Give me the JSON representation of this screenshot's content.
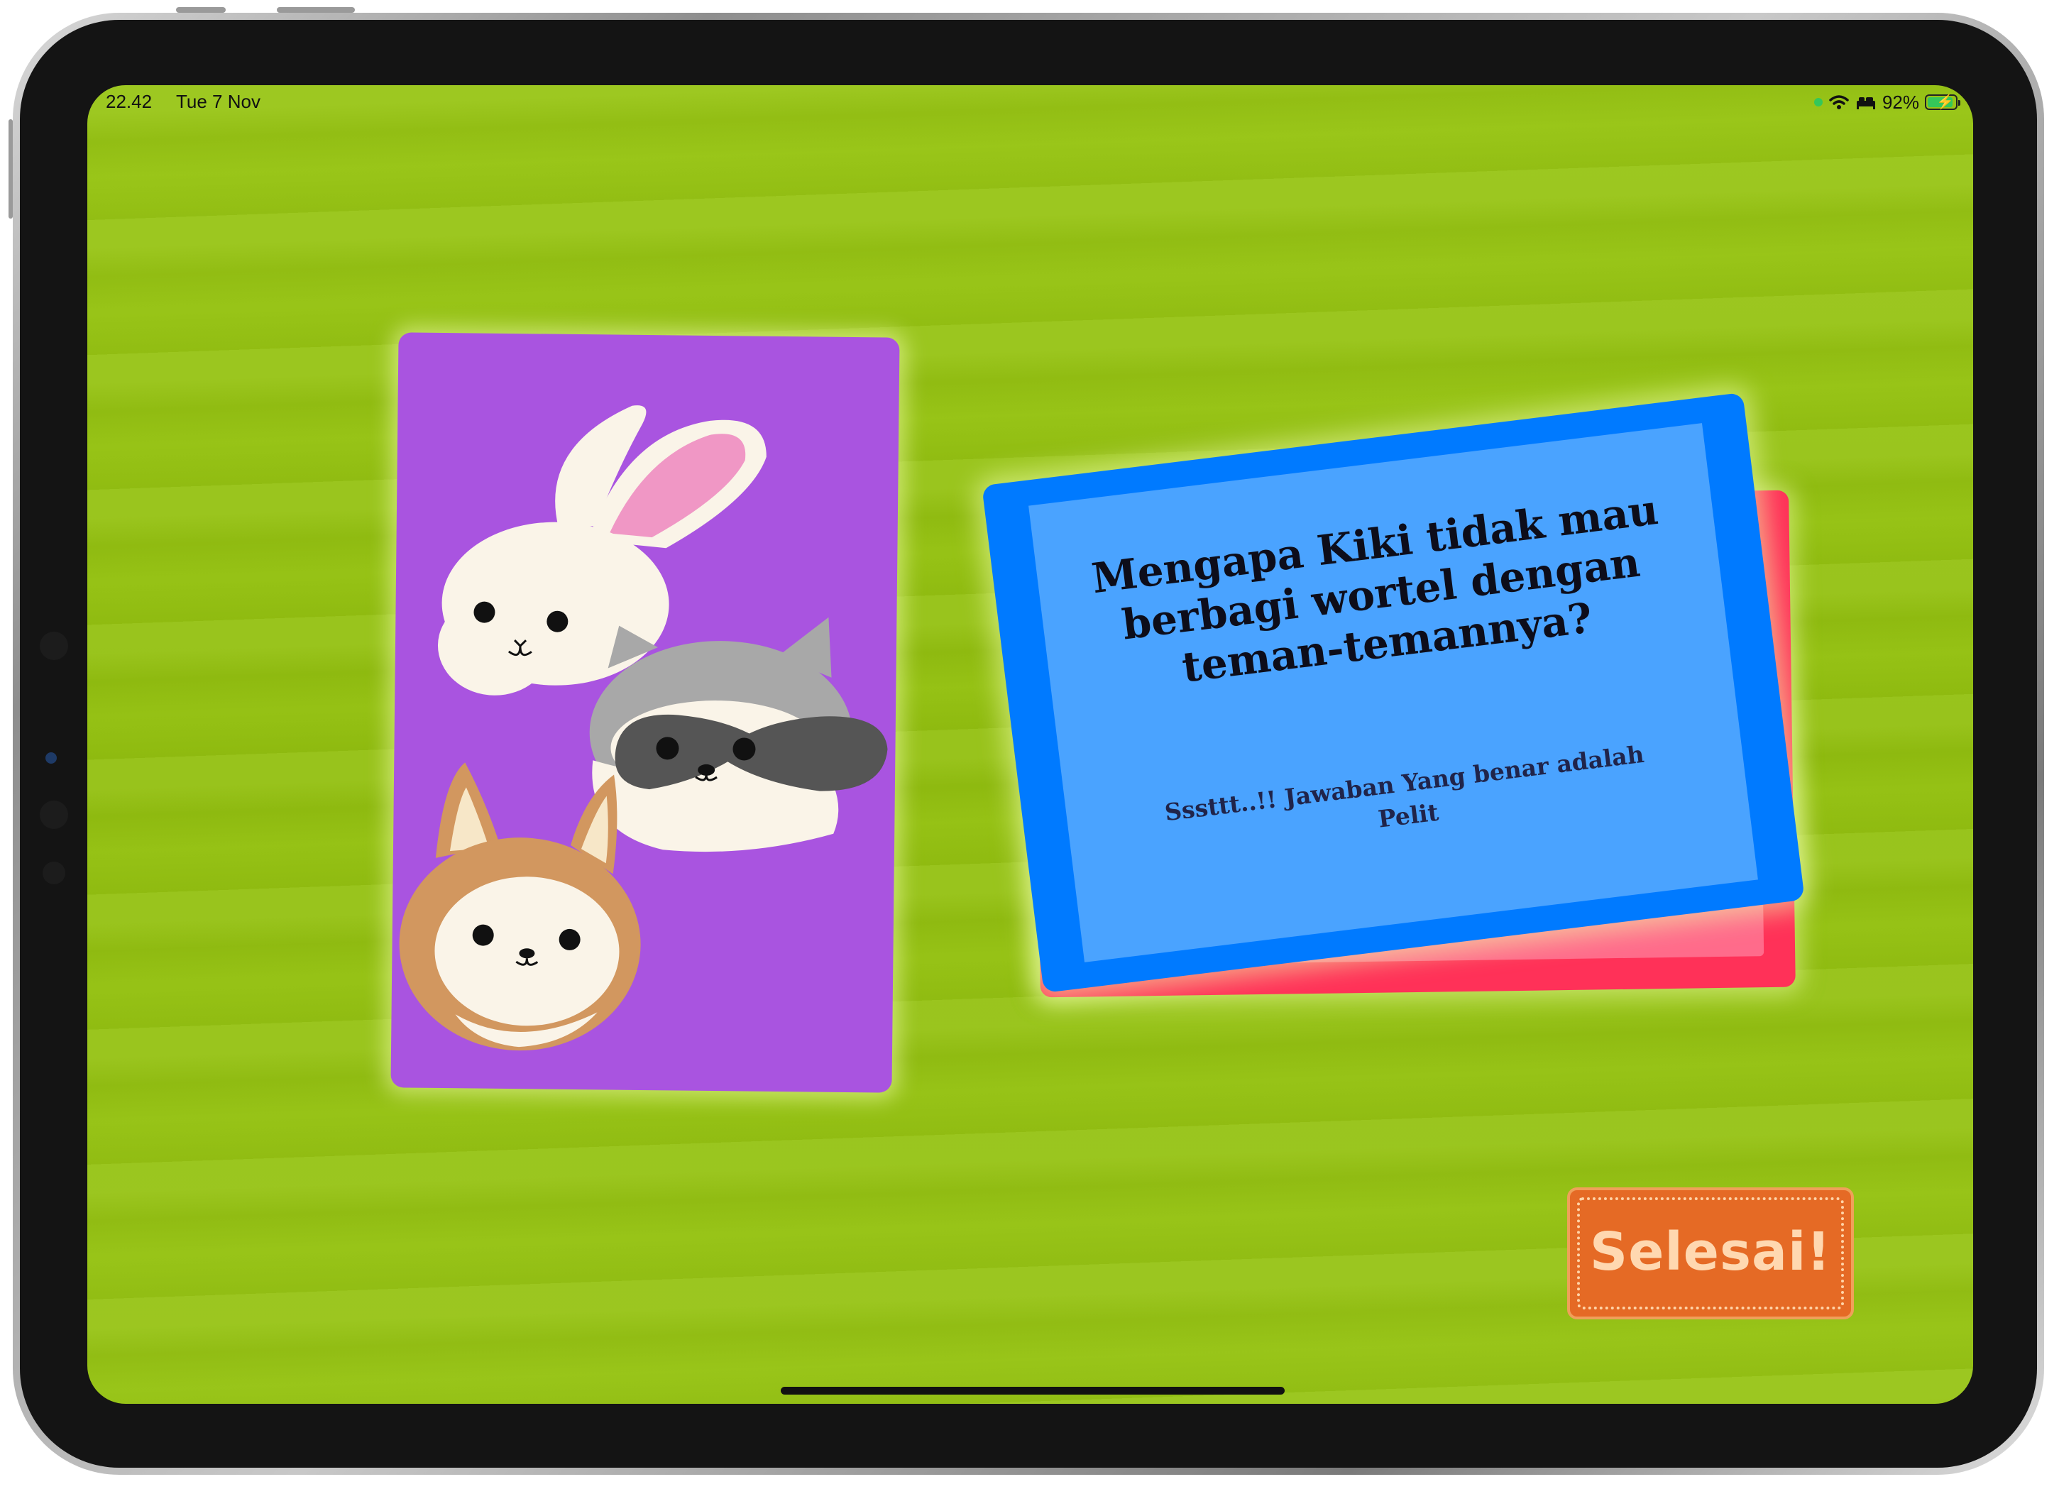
{
  "status_bar": {
    "time": "22.42",
    "date": "Tue 7 Nov",
    "battery_percent": "92%",
    "battery_level": 0.92,
    "icons": [
      "green-dot",
      "wifi-icon",
      "bed-icon",
      "battery-charging-icon"
    ]
  },
  "story_card": {
    "characters": [
      "rabbit",
      "raccoon",
      "fox"
    ],
    "background_color": "#a954e0"
  },
  "question_card": {
    "question": "Mengapa Kiki tidak mau berbagi wortel dengan teman-temannya?",
    "hint": "Sssttt..!! Jawaban Yang benar adalah Pelit",
    "front_color": "#007aff",
    "back_color": "#ff3158"
  },
  "actions": {
    "done_label": "Selesai!",
    "done_color": "#e56a25"
  },
  "colors": {
    "background": "#95c212"
  }
}
